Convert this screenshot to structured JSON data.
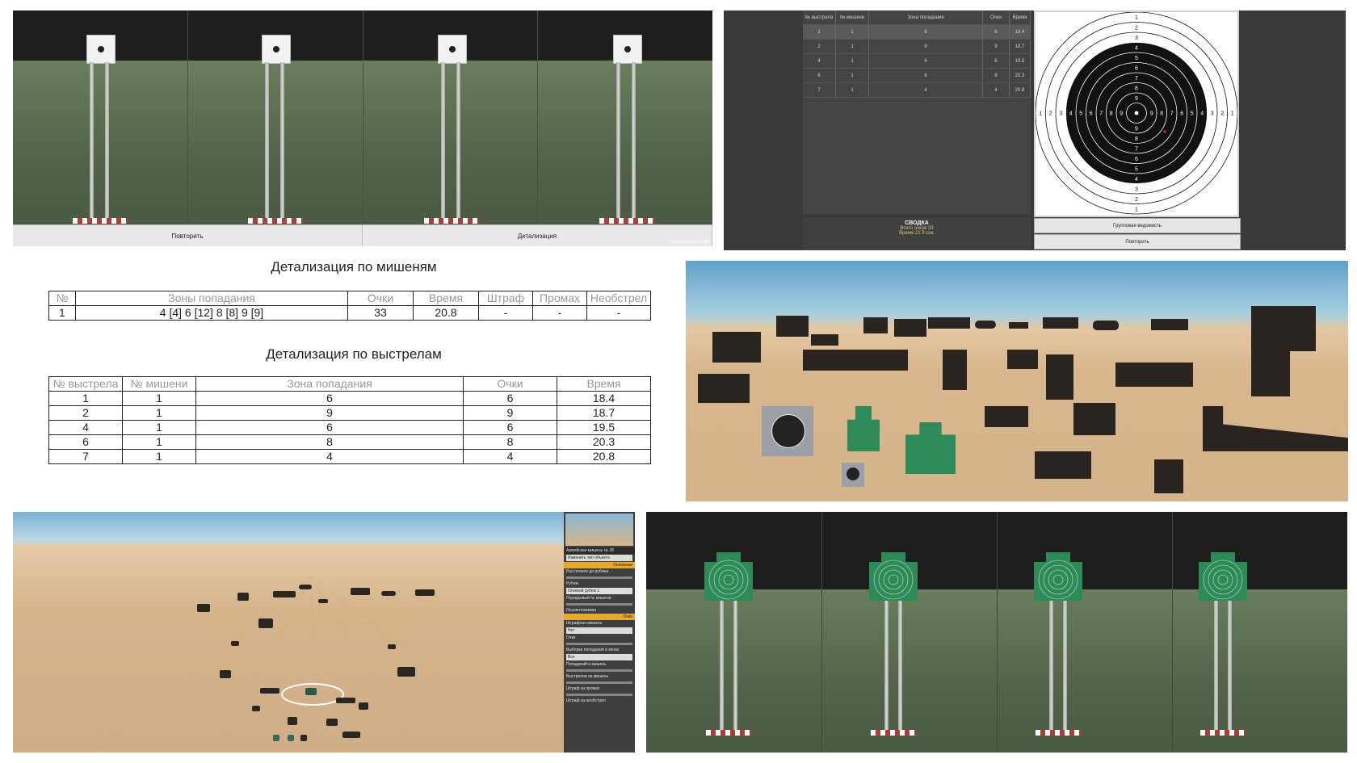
{
  "panel_range_top": {
    "buttons": [
      "Повторить",
      "Детализация"
    ],
    "dev_build": "Development Build"
  },
  "panel_results": {
    "columns": [
      "№ выстрела",
      "№ мишени",
      "Зона попадания",
      "Очки",
      "Время"
    ],
    "rows": [
      [
        "1",
        "1",
        "6",
        "6",
        "18.4"
      ],
      [
        "2",
        "1",
        "9",
        "9",
        "18.7"
      ],
      [
        "4",
        "1",
        "6",
        "6",
        "19.5"
      ],
      [
        "6",
        "1",
        "8",
        "8",
        "20.3"
      ],
      [
        "7",
        "1",
        "4",
        "4",
        "20.8"
      ]
    ],
    "summary_title": "СВОДКА",
    "summary_lines": [
      "Всего очков 33",
      "Время 21.9 сек."
    ],
    "target_rings": [
      "1",
      "2",
      "3",
      "4",
      "5",
      "6",
      "7",
      "8",
      "9"
    ],
    "buttons": [
      "Групповая ведомость",
      "Повторить"
    ]
  },
  "panel_detail": {
    "title_targets": "Детализация по мишеням",
    "targets_header": [
      "№",
      "Зоны попадания",
      "Очки",
      "Время",
      "Штраф",
      "Промах",
      "Необстрел"
    ],
    "targets_rows": [
      [
        "1",
        "4 [4] 6 [12] 8 [8] 9 [9]",
        "33",
        "20.8",
        "-",
        "-",
        "-"
      ]
    ],
    "title_shots": "Детализация по выстрелам",
    "shots_header": [
      "№ выстрела",
      "№ мишени",
      "Зона попадания",
      "Очки",
      "Время"
    ],
    "shots_rows": [
      [
        "1",
        "1",
        "6",
        "6",
        "18.4"
      ],
      [
        "2",
        "1",
        "9",
        "9",
        "18.7"
      ],
      [
        "4",
        "1",
        "6",
        "6",
        "19.5"
      ],
      [
        "6",
        "1",
        "8",
        "8",
        "20.3"
      ],
      [
        "7",
        "1",
        "4",
        "4",
        "20.8"
      ]
    ]
  },
  "panel_editor": {
    "sidebar": {
      "title": "Армейская мишень № 28",
      "change_type": "Изменить тип объекта",
      "basic": "Основные",
      "distance_label": "Расстояние до рубежа",
      "line_label": "Рубеж",
      "line_value": "Огневой рубеж 1",
      "order_label": "Порядковый № мишени",
      "indestructible": "Неуничтожимая",
      "scores": "Очки",
      "penalty_target": "Штрафная мишень",
      "penalty_value": "Нет",
      "points": "Очки",
      "hits_zone": "Выборка попаданий в зонах",
      "hits_zone_value": "Все",
      "hits_target": "Попаданий в мишень",
      "shots_target": "Выстрелов на мишень",
      "penalty_miss": "Штраф за промах",
      "penalty_noshoot": "Штраф за необстрел"
    }
  },
  "colors": {
    "grass": "#52634a",
    "sand": "#d6b48c",
    "sky": "#7fb6d8",
    "green_target": "#2f8a5a",
    "selection": "#e8a82e"
  }
}
